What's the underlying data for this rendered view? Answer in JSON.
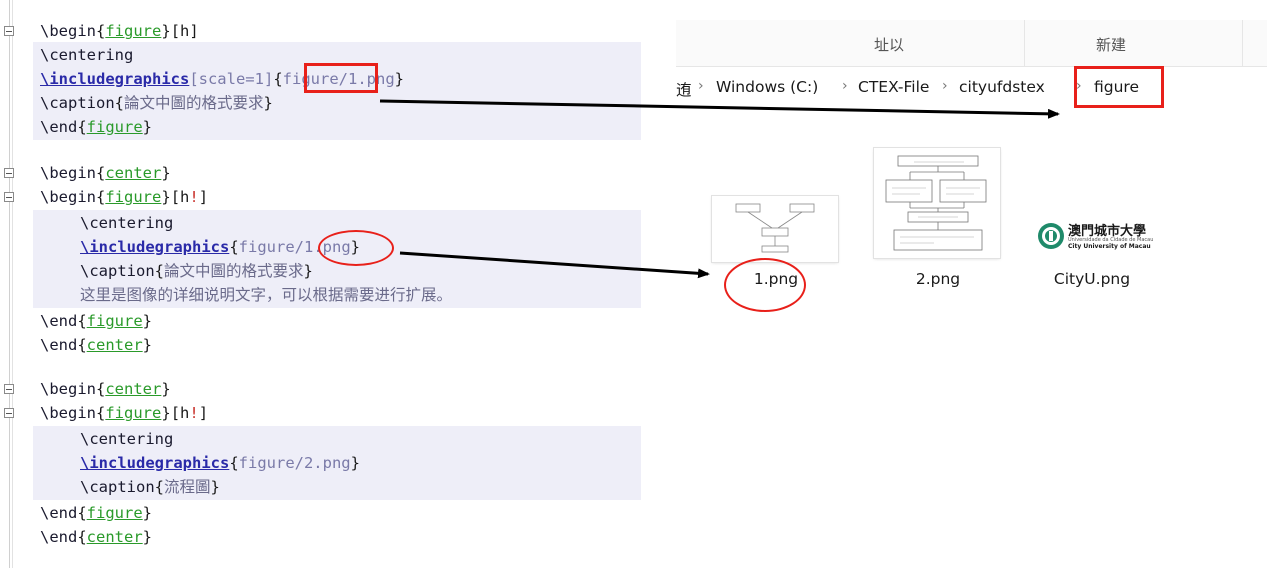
{
  "editor": {
    "block1": {
      "begin_figure": [
        "\\begin",
        "{",
        "figure",
        "}",
        "[h]"
      ],
      "centering": "\\centering",
      "includegraphics": {
        "cmd": "\\includegraphics",
        "opt": "[scale=1]",
        "open": "{",
        "path_dir": "figure",
        "path_file": "/1.png",
        "close": "}"
      },
      "caption": {
        "cmd": "\\caption",
        "open": "{",
        "text": "論文中圖的格式要求",
        "close": "}"
      },
      "end_figure": [
        "\\end",
        "{",
        "figure",
        "}"
      ]
    },
    "block2": {
      "begin_center": [
        "\\begin",
        "{",
        "center",
        "}"
      ],
      "begin_figure": [
        "\\begin",
        "{",
        "figure",
        "}",
        "[h",
        "!",
        "]"
      ],
      "centering": "\\centering",
      "includegraphics": {
        "cmd": "\\includegraphics",
        "open": "{",
        "path_dir": "figure",
        "path_file": "/1.png",
        "close": "}"
      },
      "caption": {
        "cmd": "\\caption",
        "open": "{",
        "text": "論文中圖的格式要求",
        "close": "}"
      },
      "description": "这里是图像的详细说明文字，可以根据需要进行扩展。",
      "end_figure": [
        "\\end",
        "{",
        "figure",
        "}"
      ],
      "end_center": [
        "\\end",
        "{",
        "center",
        "}"
      ]
    },
    "block3": {
      "begin_center": [
        "\\begin",
        "{",
        "center",
        "}"
      ],
      "begin_figure": [
        "\\begin",
        "{",
        "figure",
        "}",
        "[h",
        "!",
        "]"
      ],
      "centering": "\\centering",
      "includegraphics": {
        "cmd": "\\includegraphics",
        "open": "{",
        "path": "figure/2.png",
        "close": "}"
      },
      "caption": {
        "cmd": "\\caption",
        "open": "{",
        "text": "流程圖",
        "close": "}"
      },
      "end_figure": [
        "\\end",
        "{",
        "figure",
        "}"
      ],
      "end_center": [
        "\\end",
        "{",
        "center",
        "}"
      ]
    }
  },
  "explorer": {
    "breadcrumbs": [
      "迶",
      "Windows (C:)",
      "CTEX-File",
      "cityufdstex",
      "figure"
    ],
    "columns": [
      "址以",
      "新建"
    ],
    "files": [
      {
        "name": "1.png",
        "icon": "image-thumbnail-icon"
      },
      {
        "name": "2.png",
        "icon": "flowchart-thumbnail-icon"
      },
      {
        "name": "CityU.png",
        "icon": "cityu-logo-thumbnail-icon",
        "logo_text": "澳門城市大學",
        "logo_sub1": "Universidade da Cidade de Macau",
        "logo_sub2": "City University of Macau"
      }
    ]
  },
  "colors": {
    "annotation_red": "#e8201a",
    "command_blue": "#2a2aa8",
    "argument_green": "#2a9a2a",
    "highlight_band": "#eeeef8"
  }
}
